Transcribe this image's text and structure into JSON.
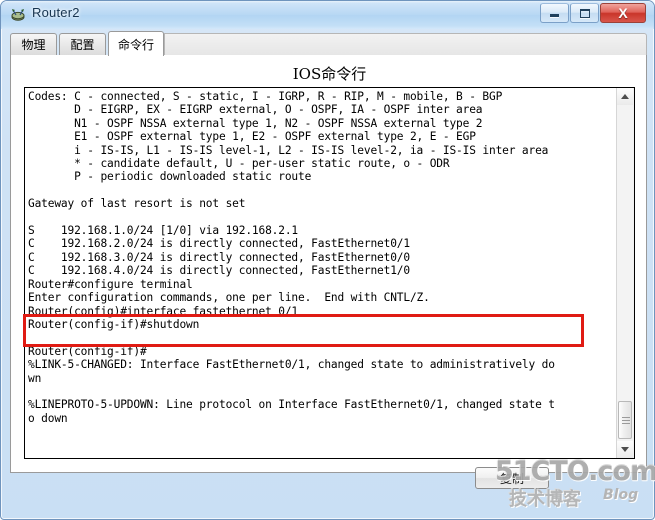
{
  "window": {
    "title": "Router2",
    "icon": "router-icon",
    "controls": {
      "minimize_label": "–",
      "maximize_label": "□",
      "close_label": "X"
    }
  },
  "tabs": [
    {
      "id": "physical",
      "label": "物理",
      "active": false
    },
    {
      "id": "config",
      "label": "配置",
      "active": false
    },
    {
      "id": "cli",
      "label": "命令行",
      "active": true
    }
  ],
  "panel": {
    "heading": "IOS命令行"
  },
  "terminal": {
    "text": "Codes: C - connected, S - static, I - IGRP, R - RIP, M - mobile, B - BGP\n       D - EIGRP, EX - EIGRP external, O - OSPF, IA - OSPF inter area\n       N1 - OSPF NSSA external type 1, N2 - OSPF NSSA external type 2\n       E1 - OSPF external type 1, E2 - OSPF external type 2, E - EGP\n       i - IS-IS, L1 - IS-IS level-1, L2 - IS-IS level-2, ia - IS-IS inter area\n       * - candidate default, U - per-user static route, o - ODR\n       P - periodic downloaded static route\n\nGateway of last resort is not set\n\nS    192.168.1.0/24 [1/0] via 192.168.2.1\nC    192.168.2.0/24 is directly connected, FastEthernet0/1\nC    192.168.3.0/24 is directly connected, FastEthernet0/0\nC    192.168.4.0/24 is directly connected, FastEthernet1/0\nRouter#configure terminal\nEnter configuration commands, one per line.  End with CNTL/Z.\nRouter(config)#interface fastethernet 0/1\nRouter(config-if)#shutdown\n\nRouter(config-if)#\n%LINK-5-CHANGED: Interface FastEthernet0/1, changed state to administratively do\nwn\n\n%LINEPROTO-5-UPDOWN: Line protocol on Interface FastEthernet0/1, changed state t\no down\n"
  },
  "annotation": {
    "color": "#e01b13",
    "highlighted_lines": [
      "Router(config)#interface fastethernet 0/1",
      "Router(config-if)#shutdown"
    ]
  },
  "scrollbar": {
    "up_arrow": "scroll-up-arrow",
    "down_arrow": "scroll-down-arrow"
  },
  "buttons": {
    "copy_label": "复制"
  },
  "watermark": {
    "top": "51CTO.com",
    "bottom": "技术博客",
    "blog": "Blog"
  }
}
